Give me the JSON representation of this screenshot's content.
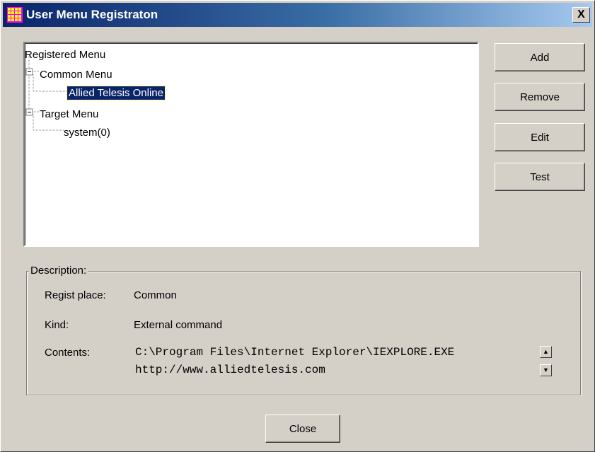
{
  "window": {
    "title": "User Menu Registraton",
    "close_glyph": "X",
    "app_icon": "grid-app-icon"
  },
  "tree": {
    "root": "Registered Menu",
    "nodes": [
      {
        "label": "Common Menu",
        "expander": "−"
      },
      {
        "label": "Allied Telesis Online",
        "selected": true
      },
      {
        "label": "Target Menu",
        "expander": "−"
      },
      {
        "label": "system(0)"
      }
    ]
  },
  "buttons": {
    "add": "Add",
    "remove": "Remove",
    "edit": "Edit",
    "test": "Test",
    "close": "Close"
  },
  "description": {
    "group_label": "Description:",
    "regist_place_label": "Regist place:",
    "regist_place_value": "Common",
    "kind_label": "Kind:",
    "kind_value": "External command",
    "contents_label": "Contents:",
    "contents_line1": "C:\\Program Files\\Internet Explorer\\IEXPLORE.EXE",
    "contents_line2": "http://www.alliedtelesis.com"
  },
  "colors": {
    "face": "#d4d0c8",
    "title_start": "#0a246a",
    "title_end": "#a6caf0",
    "selection": "#0a246a",
    "icon": "#ffff00"
  }
}
